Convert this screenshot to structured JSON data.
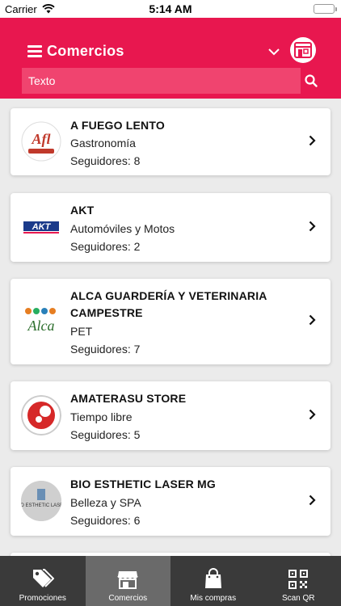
{
  "status_bar": {
    "carrier": "Carrier",
    "time": "5:14 AM"
  },
  "header": {
    "title": "Comercios"
  },
  "search": {
    "placeholder": "Texto"
  },
  "colors": {
    "primary": "#e8174f",
    "search_bg": "#f0446f",
    "tabbar_bg": "#3a3a3a",
    "tab_active_bg": "#6a6a6a"
  },
  "stores": [
    {
      "name": "A FUEGO LENTO",
      "category": "Gastronomía",
      "followers": "Seguidores: 8",
      "logo_icon": "a-fuego-lento-logo"
    },
    {
      "name": "AKT",
      "category": "Automóviles y Motos",
      "followers": "Seguidores: 2",
      "logo_icon": "akt-logo"
    },
    {
      "name": "ALCA GUARDERÍA Y VETERINARIA CAMPESTRE",
      "category": "PET",
      "followers": "Seguidores: 7",
      "logo_icon": "alca-logo"
    },
    {
      "name": "AMATERASU STORE",
      "category": "Tiempo libre",
      "followers": "Seguidores: 5",
      "logo_icon": "amaterasu-logo"
    },
    {
      "name": "BIO ESTHETIC LASER MG",
      "category": "Belleza y SPA",
      "followers": "Seguidores: 6",
      "logo_icon": "bio-esthetic-logo"
    }
  ],
  "tabs": [
    {
      "label": "Promociones",
      "icon": "tag-icon"
    },
    {
      "label": "Comercios",
      "icon": "store-icon"
    },
    {
      "label": "Mis compras",
      "icon": "shopping-bag-icon"
    },
    {
      "label": "Scan QR",
      "icon": "qr-code-icon"
    }
  ]
}
